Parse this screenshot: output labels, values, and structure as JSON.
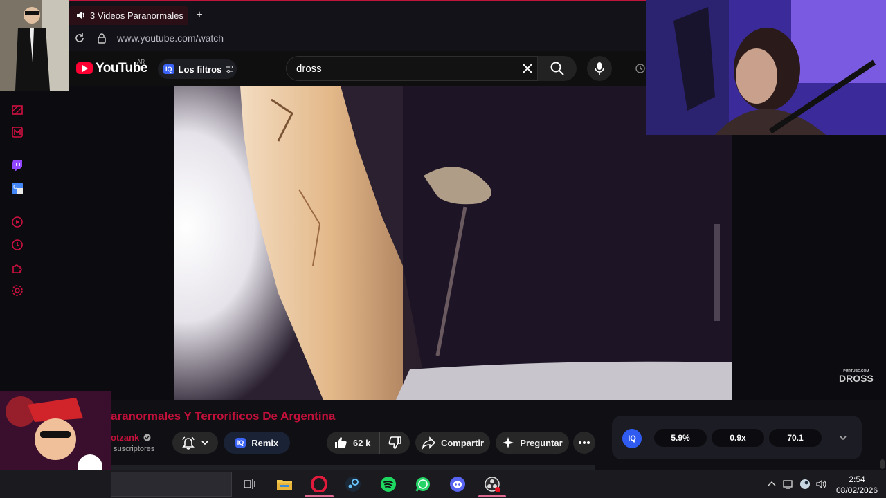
{
  "browser": {
    "tab_title": "3 Videos Paranormales",
    "new_tab_label": "+",
    "url": "www.youtube.com/watch"
  },
  "youtube": {
    "logo_text": "YouTube",
    "country_code": "AR",
    "filters_label": "Los filtros",
    "iq_badge": "IQ",
    "search_value": "dross"
  },
  "video": {
    "watermark_line1": "PURTUBE.COM",
    "watermark_line2": "DROSS",
    "title": "aranormales Y Terroríficos De Argentina",
    "channel": "otzank",
    "subscribers": "suscriptores"
  },
  "actions": {
    "remix_label": "Remix",
    "likes": "62 k",
    "share_label": "Compartir",
    "ask_label": "Preguntar"
  },
  "iq_panel": {
    "logo": "IQ",
    "stat1": "5.9%",
    "stat2": "0.9x",
    "stat3": "70.1"
  },
  "taskbar": {
    "time": "2:54",
    "date": "08/02/2026"
  },
  "colors": {
    "accent": "#c2103a",
    "youtube_red": "#ff0033",
    "iq_blue": "#3b63f6"
  },
  "icons": [
    "reload-icon",
    "lock-icon",
    "clear-icon",
    "search-icon",
    "mic-icon",
    "history-icon",
    "bell-icon",
    "like-icon",
    "dislike-icon",
    "share-icon",
    "sparkle-icon",
    "more-icon",
    "chevron-down-icon",
    "folder-icon",
    "opera-icon",
    "steam-icon",
    "spotify-icon",
    "whatsapp-icon",
    "discord-icon",
    "obs-icon"
  ]
}
